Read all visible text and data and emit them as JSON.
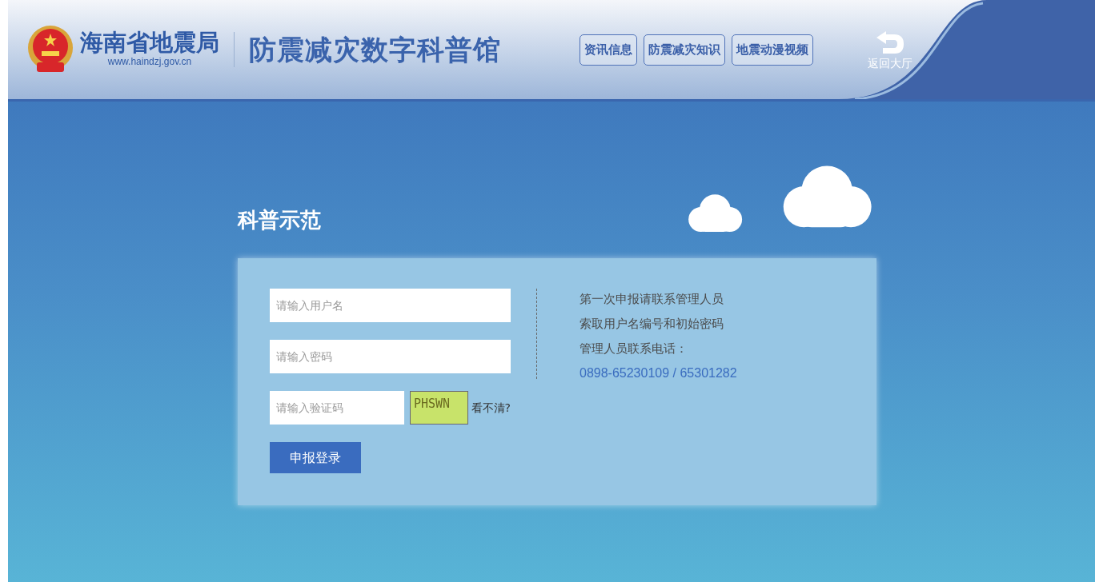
{
  "header": {
    "org_name": "海南省地震局",
    "org_url": "www.haindzj.gov.cn",
    "site_title": "防震减灾数字科普馆",
    "nav": [
      {
        "label": "资讯信息"
      },
      {
        "label": "防震减灾知识"
      },
      {
        "label": "地震动漫视频"
      }
    ],
    "back_label": "返回大厅"
  },
  "section_title": "科普示范",
  "login": {
    "username": {
      "placeholder": "请输入用户名"
    },
    "password": {
      "placeholder": "请输入密码"
    },
    "captcha": {
      "placeholder": "请输入验证码",
      "code": "PHSWN",
      "refresh": "看不清?"
    },
    "submit": "申报登录"
  },
  "info": {
    "lines": [
      "第一次申报请联系管理人员",
      "索取用户名编号和初始密码",
      "管理人员联系电话："
    ],
    "phone": "0898-65230109 / 65301282"
  }
}
